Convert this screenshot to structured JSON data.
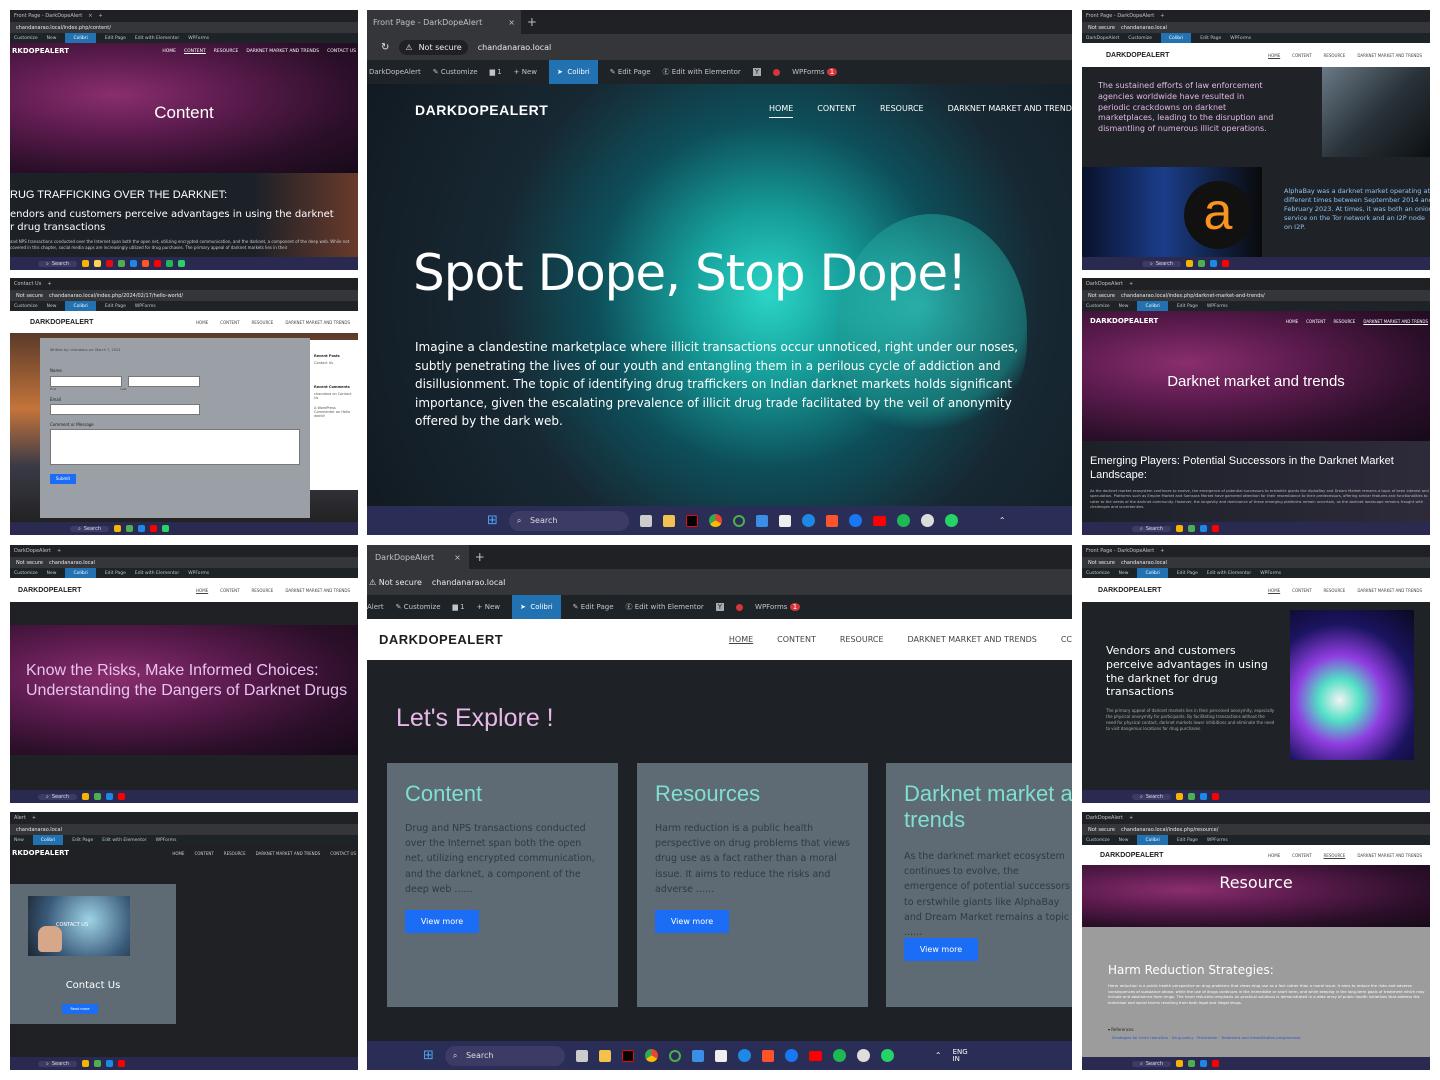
{
  "browser": {
    "front_tab": "Front Page - DarkDopeAlert",
    "tab2": "DarkDopeAlert",
    "not_secure": "Not secure",
    "url": "chandanarao.local",
    "url_content": "chandanarao.local/index.php/content/",
    "url_contact": "chandanarao.local/index.php/2024/02/17/hello-world/",
    "url_darknet": "chandanarao.local/index.php/darknet-market-and-trends/",
    "url_resource": "chandanarao.local/index.php/resource/"
  },
  "wp_admin": {
    "site": "DarkDopeAlert",
    "site_short": "Alert",
    "customize": "Customize",
    "comments": "1",
    "new": "New",
    "colibri": "Colibri",
    "edit_page": "Edit Page",
    "elementor": "Edit with Elementor",
    "wpforms": "WPForms",
    "wpforms_count": "1"
  },
  "site": {
    "logo": "DARKDOPEALERT",
    "logo_cut": "RKDOPEALERT",
    "nav": [
      "HOME",
      "CONTENT",
      "RESOURCE",
      "DARKNET MARKET AND TRENDS",
      "CC"
    ],
    "nav_contact": "CONTACT US",
    "nav_hero_cut": "DARKNET MARKET AND TRENDS"
  },
  "hero": {
    "title": "Spot Dope, Stop Dope!",
    "body": "Imagine a clandestine marketplace where illicit transactions occur unnoticed, right under our noses, subtly penetrating the lives of our youth and entangling them in a perilous cycle of addiction and disillusionment. The topic of identifying drug traffickers on Indian darknet markets holds significant importance, given the escalating prevalence of illicit drug trade facilitated by the veil of anonymity offered by the dark web."
  },
  "explore": {
    "heading": "Let's Explore !",
    "cards": [
      {
        "title": "Content",
        "body": "Drug and NPS transactions conducted over the Internet span both the open net, utilizing encrypted communication, and the darknet, a component of the deep web ......",
        "button": "View more"
      },
      {
        "title": "Resources",
        "body": "Harm reduction is a public health perspective on drug problems that views drug use as a fact rather than a moral issue. It aims to reduce the risks and adverse ......",
        "button": "View more"
      },
      {
        "title": "Darknet market and trends",
        "body": "As the darknet market ecosystem continues to evolve, the emergence of potential successors to erstwhile giants like AlphaBay and Dream Market remains a topic ......",
        "button": "View more"
      }
    ]
  },
  "thumb_content": {
    "title": "Content",
    "heading": "RUG TRAFFICKING OVER THE DARKNET:",
    "sub": "endors and customers perceive advantages in using the darknet",
    "sub2": "r drug transactions",
    "small": "and NPS transactions conducted over the Internet span both the open net, utilizing encrypted communication, and the darknet, a component of the deep web. While not covered in this chapter, social media apps are increasingly utilized for drug purchases. The primary appeal of darknet markets lies in their"
  },
  "thumb_form": {
    "meta": "Written by: chandana   on: March 7, 2024",
    "name": "Name",
    "first": "First",
    "last": "Last",
    "email": "Email",
    "comment": "Comment or Message",
    "submit": "Submit",
    "recent_posts": "Recent Posts",
    "recent_post_item": "Contact Us",
    "recent_comments": "Recent Comments",
    "comment_1": "chandana on Contact Us",
    "comment_2": "A WordPress Commenter on Hello world!"
  },
  "thumb_risks": {
    "title": "Know the Risks, Make Informed Choices: Understanding the Dangers of Darknet Drugs"
  },
  "thumb_contact": {
    "overlay": "CONTACT US",
    "label": "Contact Us",
    "button": "Read more"
  },
  "thumb_law": {
    "text": "The sustained efforts of law enforcement agencies worldwide have resulted in periodic crackdowns on darknet marketplaces, leading to the disruption and dismantling of numerous illicit operations.",
    "alphabay": "AlphaBay was a darknet market operating at different times between September 2014 and February 2023. At times, it was both an onion service on the Tor network and an I2P node on I2P.",
    "letter": "a"
  },
  "thumb_darknet": {
    "title": "Darknet market and trends",
    "heading": "Emerging Players: Potential Successors in the Darknet Market Landscape:",
    "small": "As the darknet market ecosystem continues to evolve, the emergence of potential successors to erstwhile giants like AlphaBay and Dream Market remains a topic of keen interest and speculation. Platforms such as Empire Market and Samsara Market have garnered attention for their resemblance to their predecessors, offering similar features and functionalities to cater to the needs of the darknet community. However, the longevity and dominance of these emerging platforms remain uncertain, as the darknet landscape remains fraught with challenges and uncertainties."
  },
  "thumb_vendors": {
    "heading": "Vendors and customers perceive advantages in using the darknet for drug transactions",
    "small": "The primary appeal of darknet markets lies in their perceived anonymity, especially the physical anonymity for participants. By facilitating transactions without the need for physical contact, darknet markets lower inhibitions and eliminate the need to visit dangerous locations for drug purchases."
  },
  "thumb_resource": {
    "title": "Resource",
    "heading": "Harm Reduction Strategies:",
    "small": "Harm reduction is a public health perspective on drug problems that views drug use as a fact rather than a moral issue. It aims to reduce the risks and adverse consequences of substance abuse, while the use of drugs continues in the immediate or short term, and while keeping in the long-term goals of treatment which may include and abstinence from drugs. The harm reduction emphasis on practical solutions is demonstrated in a wide array of public health initiatives that address the individual and social harms resulting from both legal and illegal drugs.",
    "refs_label": "References",
    "refs": "Strategies for harm reduction · Drug policy · Prevention · Treatment and rehabilitation programmes"
  },
  "taskbar": {
    "search": "Search",
    "lang": "ENG IN"
  }
}
